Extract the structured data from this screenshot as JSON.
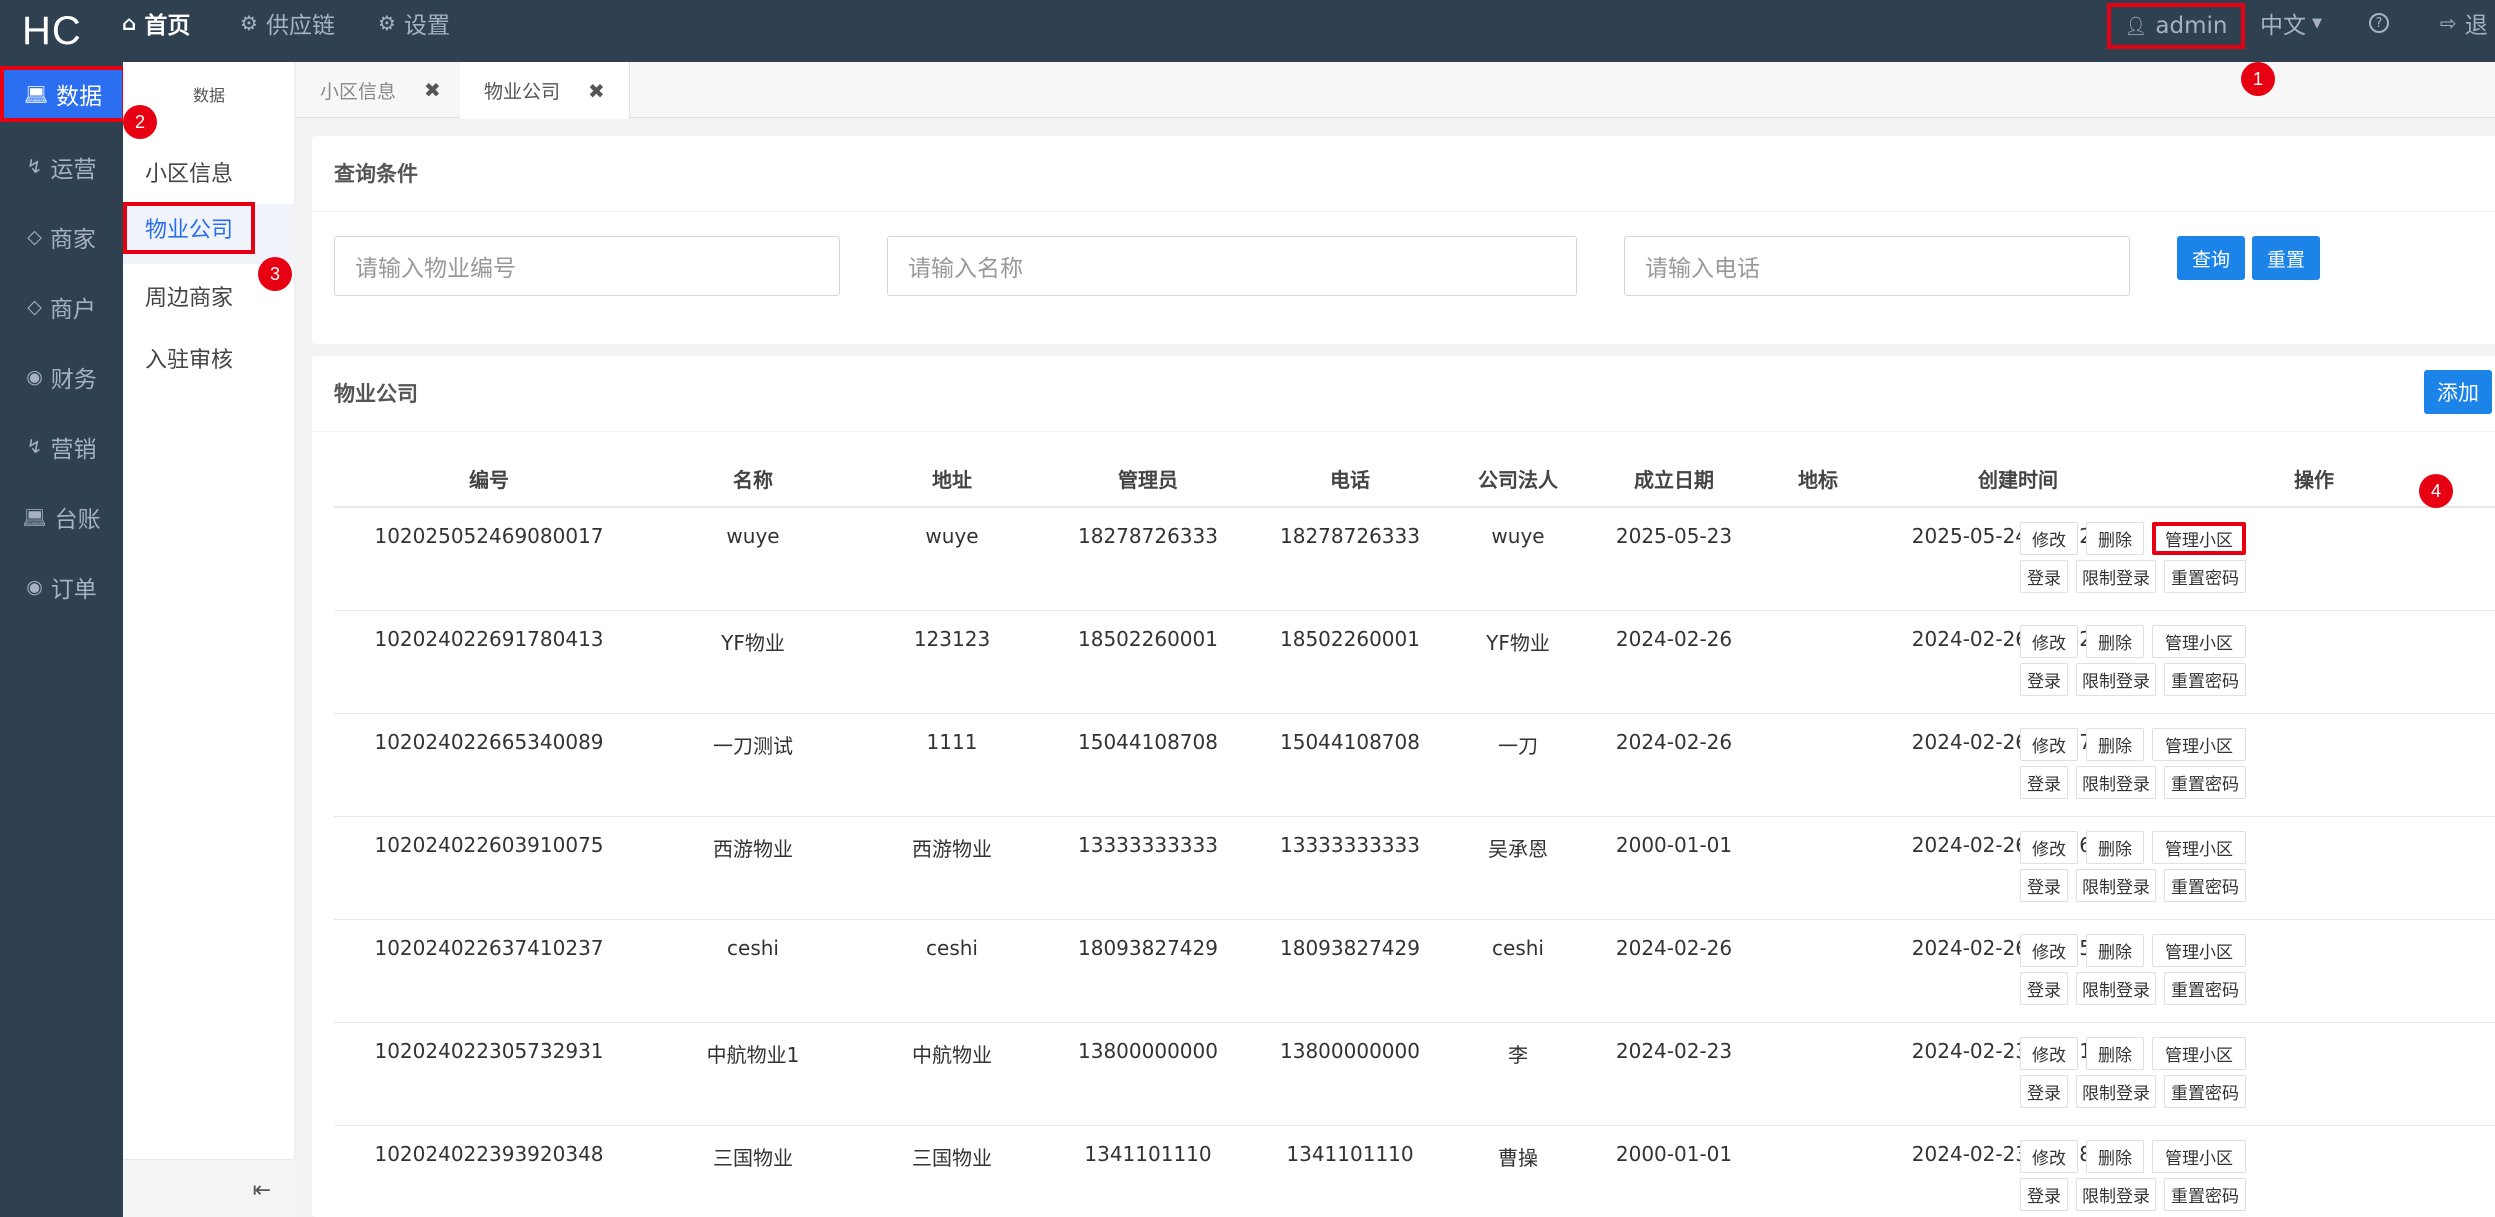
{
  "topbar": {
    "brand": "HC",
    "home": "首页",
    "supply_chain": "供应链",
    "settings": "设置",
    "user": "admin",
    "language": "中文",
    "logout": "退"
  },
  "sidebar": {
    "items": [
      {
        "label": "数据",
        "icon": "laptop-icon"
      },
      {
        "label": "运营",
        "icon": "bolt-icon"
      },
      {
        "label": "商家",
        "icon": "diamond-icon"
      },
      {
        "label": "商户",
        "icon": "diamond-icon"
      },
      {
        "label": "财务",
        "icon": "globe-icon"
      },
      {
        "label": "营销",
        "icon": "bolt-icon"
      },
      {
        "label": "台账",
        "icon": "laptop-icon"
      },
      {
        "label": "订单",
        "icon": "globe-icon"
      }
    ]
  },
  "submenu": {
    "title": "数据",
    "items": [
      "小区信息",
      "物业公司",
      "周边商家",
      "入驻审核"
    ]
  },
  "tabs": [
    "小区信息",
    "物业公司"
  ],
  "search": {
    "title": "查询条件",
    "placeholder_code": "请输入物业编号",
    "placeholder_name": "请输入名称",
    "placeholder_phone": "请输入电话",
    "query": "查询",
    "reset": "重置"
  },
  "list": {
    "title": "物业公司",
    "add": "添加",
    "columns": [
      "编号",
      "名称",
      "地址",
      "管理员",
      "电话",
      "公司法人",
      "成立日期",
      "地标",
      "创建时间",
      "操作"
    ],
    "rows": [
      [
        "102025052469080017",
        "wuye",
        "wuye",
        "18278726333",
        "18278726333",
        "wuye",
        "2025-05-23",
        "",
        "2025-05-24 14:12:14"
      ],
      [
        "102024022691780413",
        "YF物业",
        "123123",
        "18502260001",
        "18502260001",
        "YF物业",
        "2024-02-26",
        "",
        "2024-02-26 19:42:17"
      ],
      [
        "102024022665340089",
        "一刀测试",
        "1111",
        "15044108708",
        "15044108708",
        "一刀",
        "2024-02-26",
        "",
        "2024-02-26 14:27:21"
      ],
      [
        "102024022603910075",
        "西游物业",
        "西游物业",
        "13333333333",
        "13333333333",
        "吴承恩",
        "2000-01-01",
        "",
        "2024-02-26 13:56:09"
      ],
      [
        "102024022637410237",
        "ceshi",
        "ceshi",
        "18093827429",
        "18093827429",
        "ceshi",
        "2024-02-26",
        "",
        "2024-02-26 09:55:09"
      ],
      [
        "102024022305732931",
        "中航物业1",
        "中航物业",
        "13800000000",
        "13800000000",
        "李",
        "2024-02-23",
        "",
        "2024-02-23 17:31:44"
      ],
      [
        "102024022393920348",
        "三国物业",
        "三国物业",
        "1341101110",
        "1341101110",
        "曹操",
        "2000-01-01",
        "",
        "2024-02-23 09:58:55"
      ]
    ],
    "actions": [
      "修改",
      "删除",
      "管理小区",
      "登录",
      "限制登录",
      "重置密码"
    ]
  },
  "badges": [
    "1",
    "2",
    "3",
    "4"
  ]
}
